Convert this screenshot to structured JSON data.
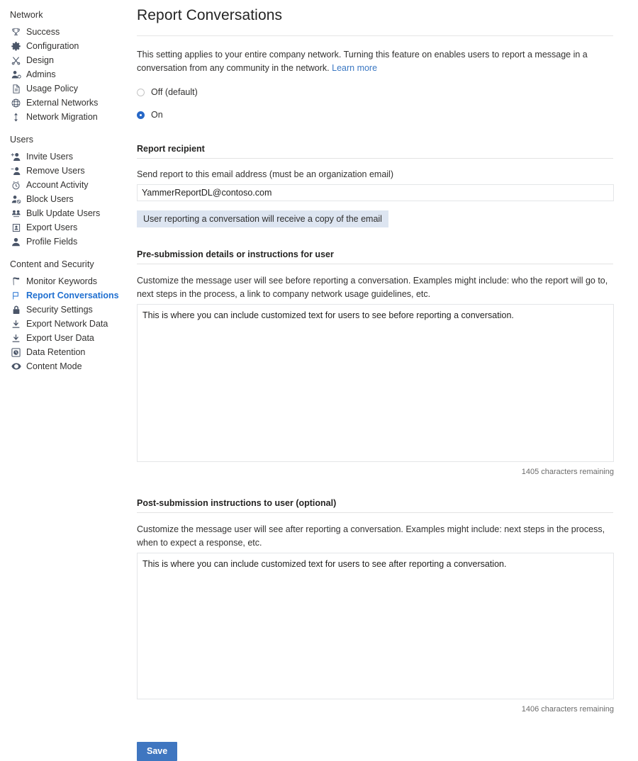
{
  "sidebar": {
    "groups": [
      {
        "title": "Network",
        "items": [
          {
            "label": "Success",
            "icon": "trophy-icon",
            "active": false
          },
          {
            "label": "Configuration",
            "icon": "gear-icon",
            "active": false
          },
          {
            "label": "Design",
            "icon": "scissors-icon",
            "active": false
          },
          {
            "label": "Admins",
            "icon": "person-gear-icon",
            "active": false
          },
          {
            "label": "Usage Policy",
            "icon": "document-icon",
            "active": false
          },
          {
            "label": "External Networks",
            "icon": "globe-icon",
            "active": false
          },
          {
            "label": "Network Migration",
            "icon": "updown-arrows-icon",
            "active": false
          }
        ]
      },
      {
        "title": "Users",
        "items": [
          {
            "label": "Invite Users",
            "icon": "person-add-icon",
            "active": false
          },
          {
            "label": "Remove Users",
            "icon": "person-remove-icon",
            "active": false
          },
          {
            "label": "Account Activity",
            "icon": "clock-icon",
            "active": false
          },
          {
            "label": "Block Users",
            "icon": "person-block-icon",
            "active": false
          },
          {
            "label": "Bulk Update Users",
            "icon": "bulk-update-icon",
            "active": false
          },
          {
            "label": "Export Users",
            "icon": "export-users-icon",
            "active": false
          },
          {
            "label": "Profile Fields",
            "icon": "person-icon",
            "active": false
          }
        ]
      },
      {
        "title": "Content and Security",
        "items": [
          {
            "label": "Monitor Keywords",
            "icon": "flag-filled-icon",
            "active": false
          },
          {
            "label": "Report Conversations",
            "icon": "flag-outline-icon",
            "active": true
          },
          {
            "label": "Security Settings",
            "icon": "lock-icon",
            "active": false
          },
          {
            "label": "Export Network Data",
            "icon": "download-icon",
            "active": false
          },
          {
            "label": "Export User Data",
            "icon": "download-icon",
            "active": false
          },
          {
            "label": "Data Retention",
            "icon": "data-retention-icon",
            "active": false
          },
          {
            "label": "Content Mode",
            "icon": "eye-icon",
            "active": false
          }
        ]
      }
    ]
  },
  "main": {
    "page_title": "Report Conversations",
    "intro_text": "This setting applies to your entire company network. Turning this feature on enables users to report a message in a conversation from any community in the network. ",
    "intro_link": "Learn more",
    "toggle": {
      "off_label": "Off (default)",
      "on_label": "On",
      "selected": "on"
    },
    "recipient": {
      "section_title": "Report recipient",
      "field_label": "Send report to this email address (must be an organization email)",
      "email_value": "YammerReportDL@contoso.com",
      "email_placeholder": "",
      "notice": "User reporting a conversation will receive a copy of the email"
    },
    "pre_submission": {
      "section_title": "Pre-submission details or instructions for user",
      "help_text": "Customize the message user will see before reporting a conversation. Examples might include: who the report will go to, next steps in the process, a link to company network usage guidelines, etc.",
      "textarea_value": "This is where you can include customized text for users to see before reporting a conversation.",
      "textarea_placeholder": "",
      "char_count": "1405 characters remaining"
    },
    "post_submission": {
      "section_title": "Post-submission instructions to user (optional)",
      "help_text": "Customize the message user will see after reporting a conversation. Examples might include: next steps in the process, when to expect a response, etc.",
      "textarea_value": "This is where you can include customized text for users to see after reporting a conversation.",
      "textarea_placeholder": "",
      "char_count": "1406 characters remaining"
    },
    "save_label": "Save"
  },
  "colors": {
    "accent_blue": "#3f76c0",
    "link_blue": "#3b78c3",
    "active_nav": "#1f6fd0",
    "notice_bg": "#dde5f1",
    "border": "#e4e6e8"
  }
}
